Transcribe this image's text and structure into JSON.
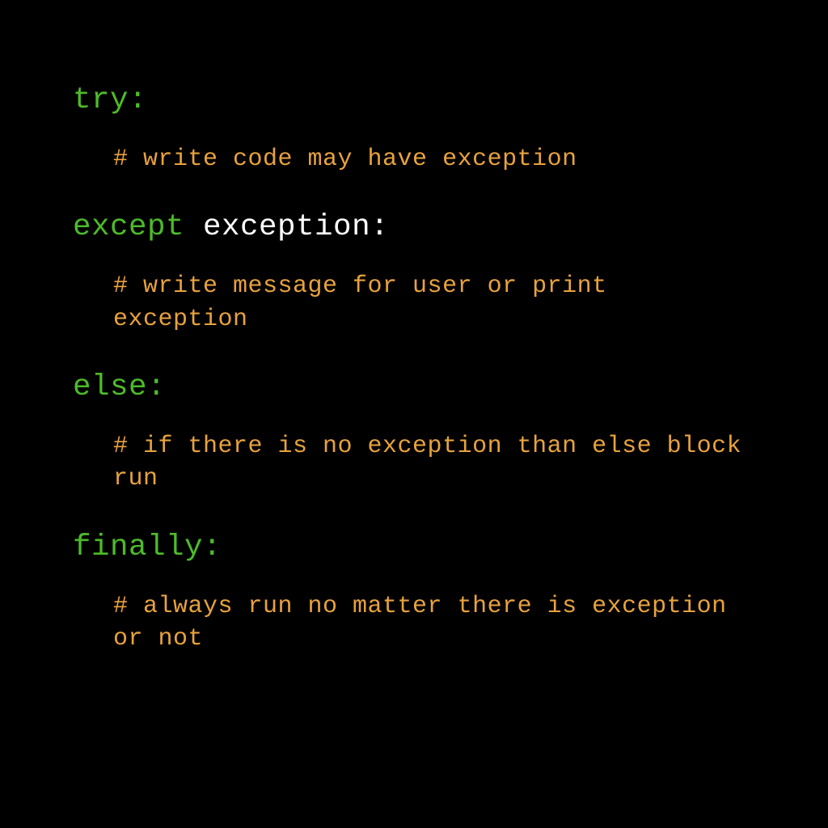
{
  "colors": {
    "keyword": "#4DBB29",
    "identifier": "#FFFFFF",
    "comment": "#E8A23D",
    "background": "#000000"
  },
  "blocks": [
    {
      "keyword": "try",
      "suffix": ":",
      "identifier": "",
      "comment": "# write code may have exception"
    },
    {
      "keyword": "except",
      "suffix": ":",
      "identifier": " exception",
      "comment": "# write message for user or\nprint exception"
    },
    {
      "keyword": "else",
      "suffix": ":",
      "identifier": "",
      "comment": "# if there is no exception than\nelse block run"
    },
    {
      "keyword": "finally",
      "suffix": ":",
      "identifier": "",
      "comment": "# always run no matter there is\nexception or not"
    }
  ]
}
